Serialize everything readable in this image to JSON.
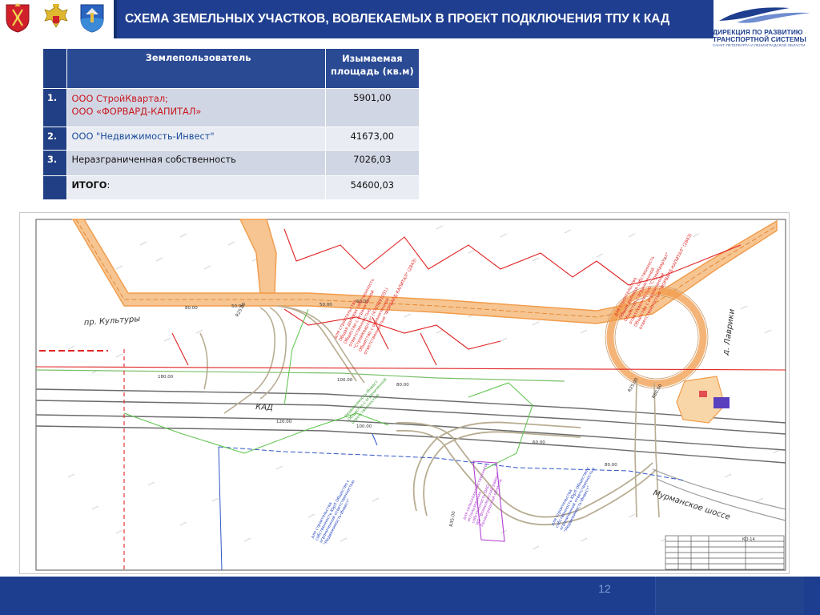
{
  "header": {
    "title": "СХЕМА ЗЕМЕЛЬНЫХ УЧАСТКОВ, ВОВЛЕКАЕМЫХ В ПРОЕКТ ПОДКЛЮЧЕНИЯ  ТПУ К КАД",
    "logo": {
      "line1": "ДИРЕКЦИЯ ПО РАЗВИТИЮ",
      "line2": "ТРАНСПОРТНОЙ СИСТЕМЫ",
      "line3": "САНКТ-ПЕТЕРБУРГА И ЛЕНИНГРАДСКОЙ ОБЛАСТИ"
    },
    "emblems": [
      "spb-coat-of-arms",
      "russia-coat-of-arms",
      "leningrad-oblast-coat-of-arms"
    ],
    "colors": {
      "title_bar": "#1f3e8f",
      "logo_text": "#1f3e8f"
    }
  },
  "table": {
    "header_user": "Землепользователь",
    "header_area": "Изымаемая площадь (кв.м)",
    "rows": [
      {
        "num": "1.",
        "user_lines": [
          "ООО СтройКвартал;",
          "ООО «ФОРВАРД-КАПИТАЛ»"
        ],
        "user_color": "red",
        "area": "5901,00"
      },
      {
        "num": "2.",
        "user_lines": [
          "ООО \"Недвижимость-Инвест\""
        ],
        "user_color": "blue",
        "area": "41673,00"
      },
      {
        "num": "3.",
        "user_lines": [
          "Неразграниченная собственность"
        ],
        "user_color": "black",
        "area": "7026,03"
      },
      {
        "num": "",
        "user_lines": [
          "ИТОГО:"
        ],
        "user_color": "black",
        "area": "54600,03",
        "bold_label": "ИТОГО"
      }
    ],
    "colors": {
      "num_column": "#213f85",
      "row_odd": "#d1d6e4",
      "row_even": "#e9ecf3",
      "red": "#c8181e",
      "blue": "#1a4c9a"
    }
  },
  "map": {
    "street_labels": {
      "kultury": "пр. Культуры",
      "kad": "КАД",
      "murmanskoe": "Мурманское шоссе",
      "lavriki": "д. Лаврики"
    },
    "dimension_labels": {
      "d80_top_left": "80.00",
      "d50_a": "50.00",
      "d50_b": "50.00",
      "d60_a": "60.00",
      "d180_left": "180.00",
      "d100": "100.00",
      "d80_mid": "80.00",
      "d120": "120.00",
      "d100_lower": "100.00",
      "d60_right": "60.00",
      "d80_right": "80.00",
      "r_a": "R25.00",
      "r_b": "R25.00",
      "r_c": "R80.00",
      "r_d": "R35.00"
    },
    "annotations": {
      "red_block_a_lines": [
        "для строительства",
        "Общая долевая собственность",
        "Общество с ограниченной",
        "ответственностью",
        "\"СтройКвартал\" (4705091051)",
        "Общество с ограниченной",
        "ответственностью \"ФОРВАРД-КАПИТАЛ\" (2843)"
      ],
      "red_block_b_lines": [
        "для строительства",
        "Общая долевая собственность",
        "Общество с ограниченной",
        "ответственностью \"СтройКвартал\"",
        "Общество с ограниченной",
        "ответственностью \"ФОРВАРД-КАПИТАЛ\" (2843)"
      ],
      "green_block_lines": [
        "Недвижимость-Инвест",
        "Общество с ограниченной",
        "ответственностью"
      ],
      "purple_block_lines": [
        "для сельскохозяйственного",
        "использования",
        "собственность ОАО",
        "МО \"Всеволожский район\"",
        "Ленинградской области"
      ],
      "blue_block_a_lines": [
        "для строительства",
        "собственность ЮрЛ Общество с",
        "ограниченной ответственностью",
        "\"Недвижимость-Инвест\""
      ],
      "blue_block_b_lines": [
        "для строительства",
        "собственность ЮрЛ Общество с",
        "ограниченной ответственностью",
        "\"Недвижимость-Инвест\""
      ]
    },
    "stamp": {
      "sheet": "КО-14"
    },
    "colors": {
      "road_orange": "#f19b4a",
      "road_fill": "#f6c591",
      "ramp_line": "#b8ad92",
      "kad_line": "#6b6b6b",
      "parcel_red": "#e02424",
      "parcel_green": "#5bc24a",
      "parcel_blue": "#2f55c7",
      "parcel_purple": "#b040d0",
      "text_blue": "#2040c0"
    }
  },
  "footer": {
    "page_number": "12"
  }
}
